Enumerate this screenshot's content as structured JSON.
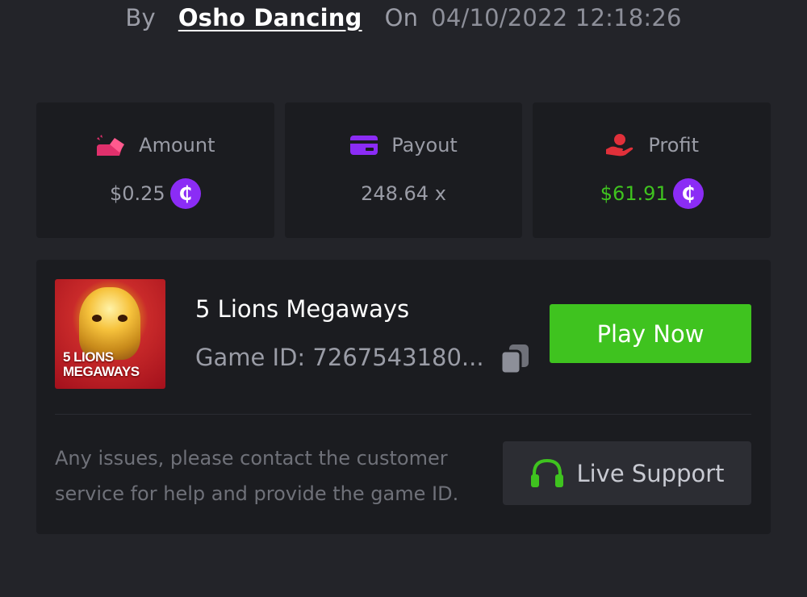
{
  "header": {
    "by_label": "By",
    "username": "Osho Dancing",
    "on_label": "On",
    "datetime": "04/10/2022 12:18:26"
  },
  "stats": {
    "amount": {
      "label": "Amount",
      "value": "$0.25",
      "icon": "wallet-tag-icon",
      "icon_color": "#e0306c"
    },
    "payout": {
      "label": "Payout",
      "value": "248.64 x",
      "icon": "credit-card-icon",
      "icon_color": "#8b2cf5"
    },
    "profit": {
      "label": "Profit",
      "value": "$61.91",
      "icon": "hand-money-icon",
      "icon_color": "#e0303a",
      "value_color": "#3fc31f"
    },
    "coin_symbol": "₵",
    "coin_color": "#8b2cf5"
  },
  "game": {
    "thumbnail_text": "5 LIONS MEGAWAYS",
    "name": "5 Lions Megaways",
    "id_text": "Game ID: 7267543180...",
    "play_label": "Play Now",
    "play_color": "#3fc31f"
  },
  "support": {
    "help_text": "Any issues, please contact the customer service for help and provide the game ID.",
    "button_label": "Live Support",
    "icon": "headset-icon",
    "icon_color": "#3fc31f"
  },
  "colors": {
    "background": "#232429",
    "card": "#1b1c20",
    "muted_text": "#9a9ca6"
  }
}
